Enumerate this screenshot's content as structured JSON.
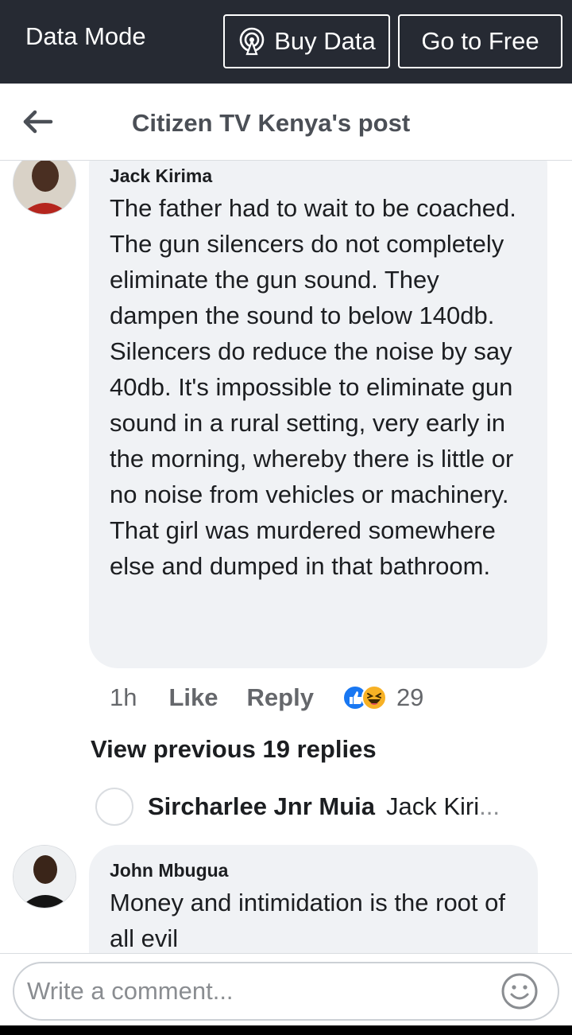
{
  "data_mode": {
    "label": "Data Mode",
    "buy_label": "Buy Data",
    "free_label": "Go to Free"
  },
  "header": {
    "title": "Citizen TV Kenya's post"
  },
  "comments": [
    {
      "author": "Jack Kirima",
      "text": "The father had to wait to be coached. The gun silencers do not completely eliminate the gun sound. They dampen the sound to below 140db. Silencers do reduce the noise by say 40db. It's impossible to eliminate gun sound in a rural setting, very early in the morning, whereby there is little or no noise from vehicles or machinery. That girl was murdered somewhere else and dumped in that bathroom.",
      "time": "1h",
      "like_label": "Like",
      "reply_label": "Reply",
      "reaction_count": "29",
      "view_previous": "View previous 19 replies",
      "reply_preview": {
        "author": "Sircharlee Jnr Muia",
        "snippet": "Jack Kiri",
        "ellipsis": "..."
      }
    },
    {
      "author": "John Mbugua",
      "text": "Money and intimidation is the root of all evil"
    }
  ],
  "composer": {
    "placeholder": "Write a comment..."
  },
  "colors": {
    "data_bar": "#262a33",
    "bubble": "#f0f2f5",
    "like_blue": "#1877f2",
    "haha_yellow": "#f7b125"
  }
}
